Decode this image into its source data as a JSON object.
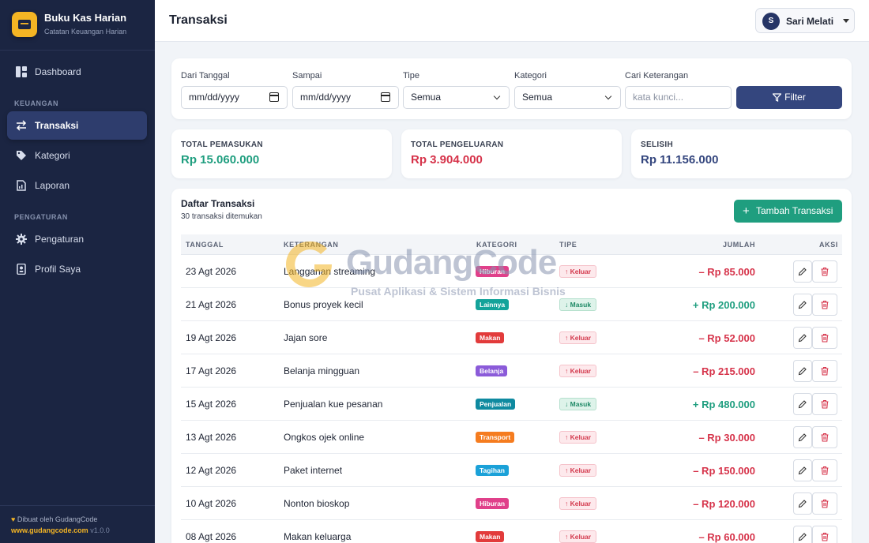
{
  "app": {
    "name": "Buku Kas Harian",
    "subtitle": "Catatan Keuangan Harian"
  },
  "nav": {
    "items_top": [
      {
        "label": "Dashboard",
        "icon": "dashboard-icon"
      }
    ],
    "section_finance": "KEUANGAN",
    "finance_items": [
      {
        "label": "Transaksi",
        "icon": "transfer-icon",
        "active": true
      },
      {
        "label": "Kategori",
        "icon": "tag-icon"
      },
      {
        "label": "Laporan",
        "icon": "report-icon"
      }
    ],
    "section_settings": "PENGATURAN",
    "settings_items": [
      {
        "label": "Pengaturan",
        "icon": "gear-icon"
      },
      {
        "label": "Profil Saya",
        "icon": "profile-icon"
      }
    ]
  },
  "footer": {
    "made_by": "Dibuat oleh GudangCode",
    "site": "www.gudangcode.com",
    "version": "v1.0.0"
  },
  "header": {
    "title": "Transaksi",
    "user_initial": "S",
    "user_name": "Sari Melati"
  },
  "filters": {
    "from_label": "Dari Tanggal",
    "from_value": "mm/dd/yyyy",
    "to_label": "Sampai",
    "to_value": "mm/dd/yyyy",
    "type_label": "Tipe",
    "type_value": "Semua",
    "category_label": "Kategori",
    "category_value": "Semua",
    "search_label": "Cari Keterangan",
    "search_placeholder": "kata kunci...",
    "button": "Filter"
  },
  "stats": {
    "income_label": "TOTAL PEMASUKAN",
    "income_value": "Rp 15.060.000",
    "expense_label": "TOTAL PENGELUARAN",
    "expense_value": "Rp 3.904.000",
    "diff_label": "SELISIH",
    "diff_value": "Rp 11.156.000"
  },
  "list": {
    "title": "Daftar Transaksi",
    "count": "30 transaksi ditemukan",
    "add_button": "Tambah Transaksi",
    "columns": {
      "date": "TANGGAL",
      "desc": "KETERANGAN",
      "category": "KATEGORI",
      "type": "TIPE",
      "amount": "JUMLAH",
      "actions": "AKSI"
    },
    "rows": [
      {
        "date": "23 Agt 2026",
        "desc": "Langganan streaming",
        "category": "Hiburan",
        "cat_color": "#e0408a",
        "type": "↑ Keluar",
        "dir": "out",
        "amount": "– Rp 85.000"
      },
      {
        "date": "21 Agt 2026",
        "desc": "Bonus proyek kecil",
        "category": "Lainnya",
        "cat_color": "#14a39a",
        "type": "↓ Masuk",
        "dir": "in",
        "amount": "+ Rp 200.000"
      },
      {
        "date": "19 Agt 2026",
        "desc": "Jajan sore",
        "category": "Makan",
        "cat_color": "#e23b3b",
        "type": "↑ Keluar",
        "dir": "out",
        "amount": "– Rp 52.000"
      },
      {
        "date": "17 Agt 2026",
        "desc": "Belanja mingguan",
        "category": "Belanja",
        "cat_color": "#8b5bd9",
        "type": "↑ Keluar",
        "dir": "out",
        "amount": "– Rp 215.000"
      },
      {
        "date": "15 Agt 2026",
        "desc": "Penjualan kue pesanan",
        "category": "Penjualan",
        "cat_color": "#0f8aa0",
        "type": "↓ Masuk",
        "dir": "in",
        "amount": "+ Rp 480.000"
      },
      {
        "date": "13 Agt 2026",
        "desc": "Ongkos ojek online",
        "category": "Transport",
        "cat_color": "#f57c1f",
        "type": "↑ Keluar",
        "dir": "out",
        "amount": "– Rp 30.000"
      },
      {
        "date": "12 Agt 2026",
        "desc": "Paket internet",
        "category": "Tagihan",
        "cat_color": "#1ba1d8",
        "type": "↑ Keluar",
        "dir": "out",
        "amount": "– Rp 150.000"
      },
      {
        "date": "10 Agt 2026",
        "desc": "Nonton bioskop",
        "category": "Hiburan",
        "cat_color": "#e0408a",
        "type": "↑ Keluar",
        "dir": "out",
        "amount": "– Rp 120.000"
      },
      {
        "date": "08 Agt 2026",
        "desc": "Makan keluarga",
        "category": "Makan",
        "cat_color": "#e23b3b",
        "type": "↑ Keluar",
        "dir": "out",
        "amount": "– Rp 60.000"
      }
    ]
  },
  "watermark": {
    "title": "GudangCode",
    "subtitle": "Pusat Aplikasi & Sistem Informasi Bisnis"
  },
  "colors": {
    "sidebar": "#1b2542",
    "accent": "#34467e",
    "income": "#1f9e7f",
    "expense": "#d6334a",
    "diff": "#34467e",
    "brand": "#f4b524"
  }
}
